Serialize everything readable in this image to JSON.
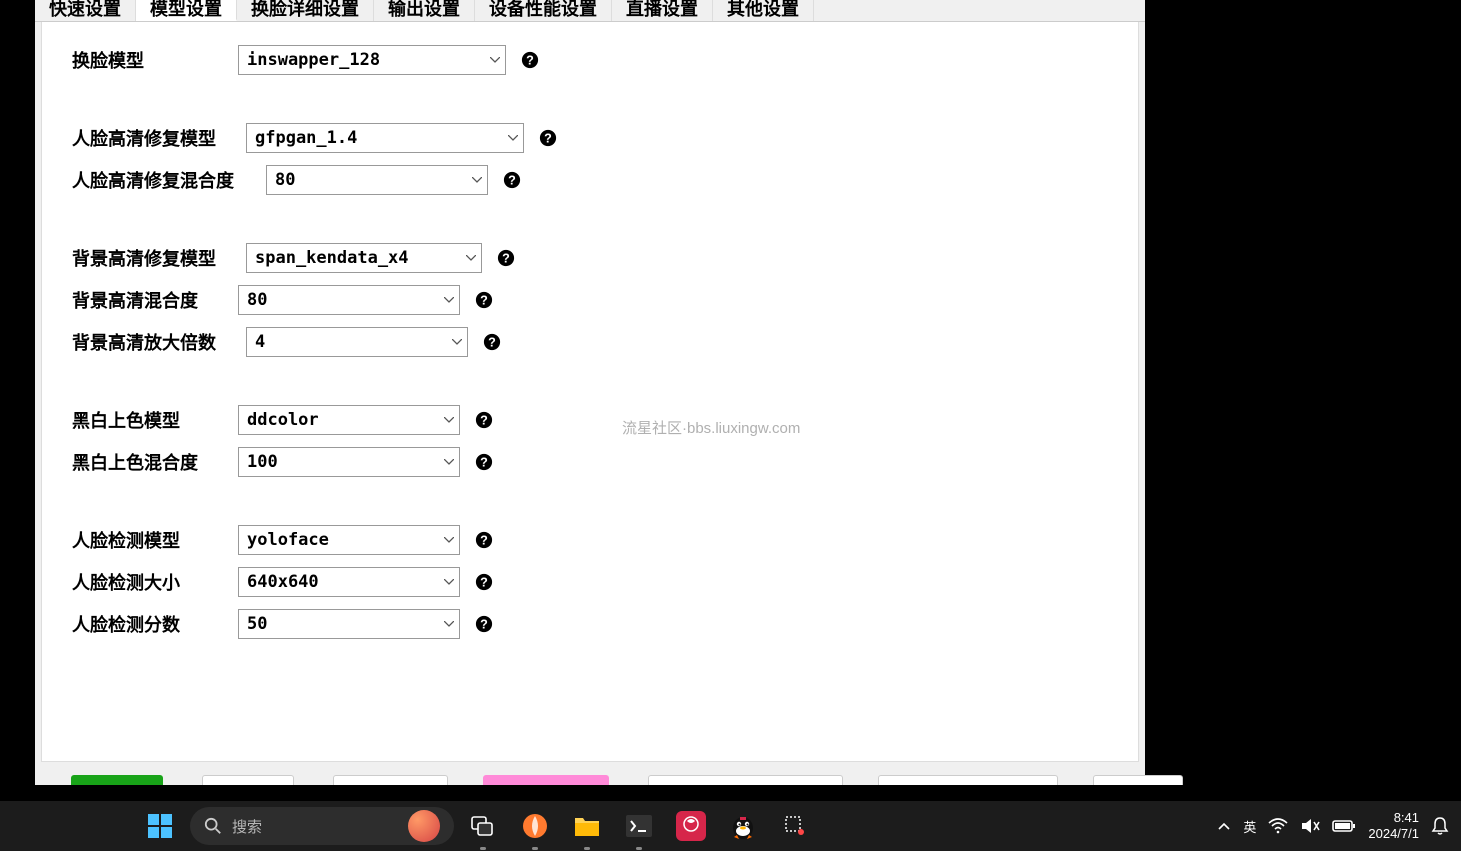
{
  "tabs": [
    "快速设置",
    "模型设置",
    "换脸详细设置",
    "输出设置",
    "设备性能设置",
    "直播设置",
    "其他设置"
  ],
  "active_tab": 1,
  "watermark": "流星社区·bbs.liuxingw.com",
  "fields": {
    "face_swap_model": {
      "label": "换脸模型",
      "value": "inswapper_128"
    },
    "face_restore_model": {
      "label": "人脸高清修复模型",
      "value": "gfpgan_1.4"
    },
    "face_restore_blend": {
      "label": "人脸高清修复混合度",
      "value": "80"
    },
    "bg_restore_model": {
      "label": "背景高清修复模型",
      "value": "span_kendata_x4"
    },
    "bg_restore_blend": {
      "label": "背景高清混合度",
      "value": "80"
    },
    "bg_upscale": {
      "label": "背景高清放大倍数",
      "value": "4"
    },
    "colorize_model": {
      "label": "黑白上色模型",
      "value": "ddcolor"
    },
    "colorize_blend": {
      "label": "黑白上色混合度",
      "value": "100"
    },
    "face_detect_model": {
      "label": "人脸检测模型",
      "value": "yoloface"
    },
    "face_detect_size": {
      "label": "人脸检测大小",
      "value": "640x640"
    },
    "face_detect_score": {
      "label": "人脸检测分数",
      "value": "50"
    }
  },
  "taskbar": {
    "search_placeholder": "搜索",
    "ime": "英",
    "time": "8:41",
    "date": "2024/7/1"
  }
}
